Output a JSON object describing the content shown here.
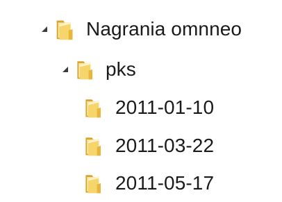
{
  "tree": {
    "root": {
      "label": "Nagrania omnneo",
      "expanded": true,
      "icon": "folder-icon",
      "children": [
        {
          "label": "pks",
          "expanded": true,
          "icon": "folder-icon",
          "children": [
            {
              "label": "2011-01-10",
              "icon": "folder-icon"
            },
            {
              "label": "2011-03-22",
              "icon": "folder-icon"
            },
            {
              "label": "2011-05-17",
              "icon": "folder-icon"
            }
          ]
        }
      ]
    }
  },
  "colors": {
    "folder_dark": "#d9a32c",
    "folder_light": "#f6d56b",
    "folder_inner": "#fbe7a8",
    "toggle": "#3b3b3b"
  }
}
